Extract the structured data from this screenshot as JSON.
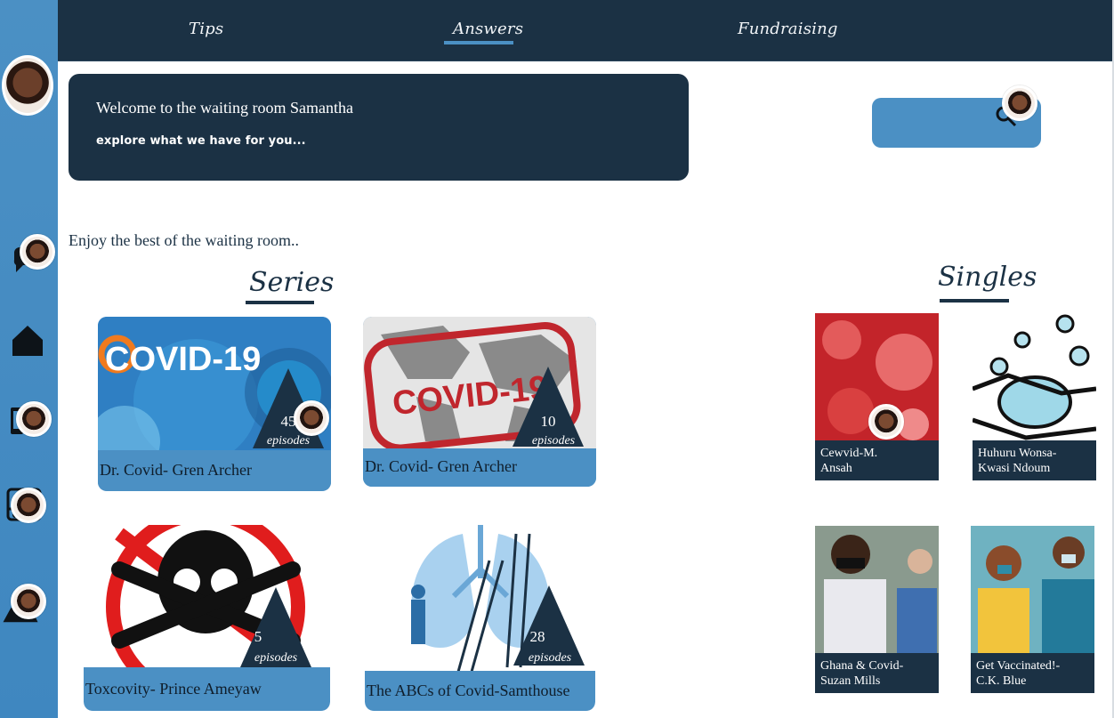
{
  "nav": {
    "items": [
      {
        "label": "Tips"
      },
      {
        "label": "Answers"
      },
      {
        "label": "Fundraising"
      }
    ]
  },
  "welcome": {
    "title": "Welcome to the waiting room Samantha",
    "subtitle": "explore what we have for you..."
  },
  "enjoy_text": "Enjoy the best of the waiting room..",
  "sections": {
    "series": "Series",
    "singles": "Singles"
  },
  "series": [
    {
      "title": "Dr. Covid- Gren Archer",
      "count": "45",
      "unit": "episodes",
      "banner": "COVID-19"
    },
    {
      "title": "Dr. Covid- Gren Archer",
      "count": "10",
      "unit": "episodes",
      "banner": "COVID-19"
    },
    {
      "title": "Toxcovity- Prince Ameyaw",
      "count": "5",
      "unit": "episodes"
    },
    {
      "title": "The ABCs of Covid-Samthouse",
      "count": "28",
      "unit": "episodes"
    }
  ],
  "singles": [
    {
      "line1": "Cewvid-M.",
      "line2": "Ansah"
    },
    {
      "line1": "Huhuru Wonsa-",
      "line2": "Kwasi Ndoum"
    },
    {
      "line1": "Ghana & Covid-",
      "line2": "Suzan Mills"
    },
    {
      "line1": "Get Vaccinated!-",
      "line2": "C.K. Blue"
    }
  ],
  "icons": {
    "chat": "chat-icon",
    "home": "home-icon",
    "phone": "phone-icon",
    "bus": "bus-icon",
    "map": "map-icon",
    "search": "search-icon"
  },
  "colors": {
    "navy": "#1b3144",
    "blue": "#4b90c4",
    "white": "#ffffff"
  }
}
